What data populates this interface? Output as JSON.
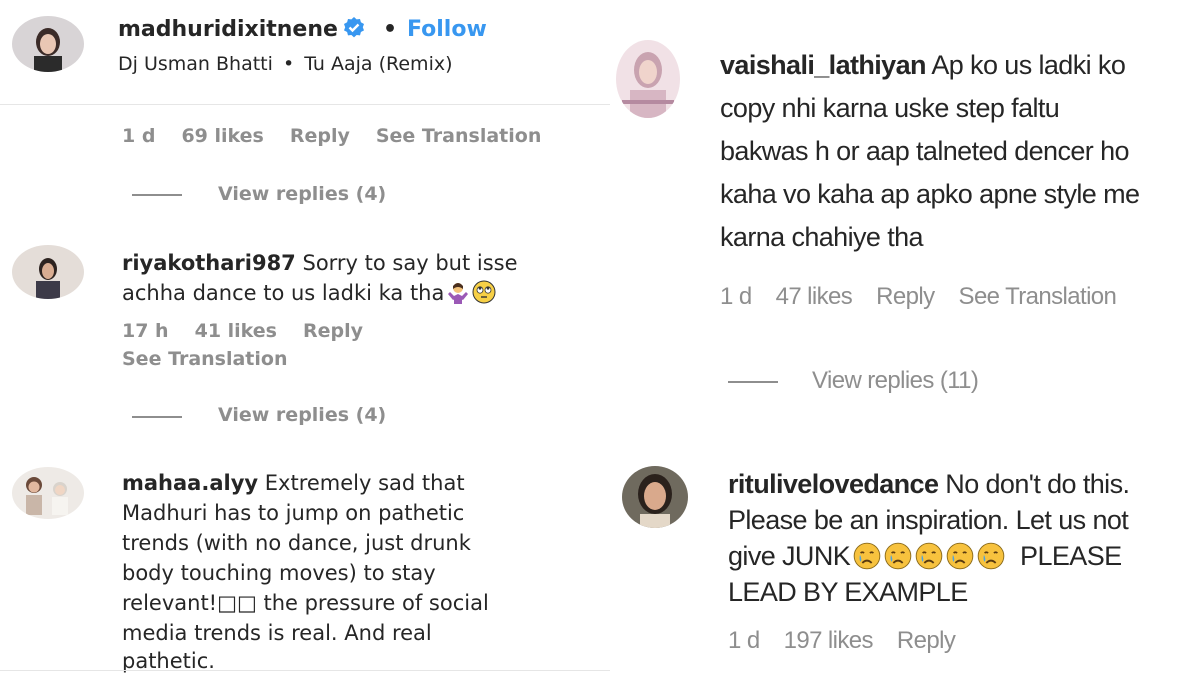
{
  "left": {
    "post_header": {
      "username": "madhuridixitnene",
      "separator": "•",
      "follow_label": "Follow",
      "audio_artist": "Dj Usman Bhatti",
      "audio_sep": "•",
      "audio_track": "Tu Aaja (Remix)"
    },
    "first_meta": {
      "time": "1 d",
      "likes": "69 likes",
      "reply": "Reply",
      "translate": "See Translation"
    },
    "first_view_replies": "View replies (4)",
    "comments": [
      {
        "username": "riyakothari987",
        "line1": "Sorry to say but isse",
        "line2": "achha dance to us ladki ka tha",
        "emojis": [
          "woman-gesturing-icon",
          "rolling-eyes-icon"
        ],
        "time": "17 h",
        "likes": "41 likes",
        "reply": "Reply",
        "translate": "See Translation",
        "view_replies": "View replies (4)"
      },
      {
        "username": "mahaa.alyy",
        "line1": "Extremely sad that",
        "line2": "Madhuri has to jump on pathetic",
        "line3": "trends (with no dance, just drunk",
        "line4": "body touching moves) to stay",
        "line5": "relevant!□□ the pressure of social",
        "line6": "media trends is real. And real",
        "line7": "pathetic."
      }
    ]
  },
  "right": {
    "comments": [
      {
        "username": "vaishali_lathiyan",
        "line1": "Ap ko us ladki ko",
        "line2": "copy nhi karna uske step faltu",
        "line3": "bakwas h or aap talneted dencer ho",
        "line4": "kaha vo kaha ap apko apne style me",
        "line5": "karna chahiye tha",
        "time": "1 d",
        "likes": "47 likes",
        "reply": "Reply",
        "translate": "See Translation",
        "view_replies": "View replies (11)"
      },
      {
        "username": "ritulivelovedance",
        "line1": "No don't do this.",
        "line2": "Please be an inspiration. Let us not",
        "line3_prefix": "give JUNK",
        "line3_suffix": "PLEASE",
        "line4": "LEAD BY EXAMPLE",
        "crying_emoji_count": 5,
        "time": "1 d",
        "likes": "197 likes",
        "reply": "Reply"
      }
    ]
  },
  "colors": {
    "text": "#262626",
    "meta": "#8e8e8e",
    "follow": "#3897f0",
    "verified": "#3897f0",
    "divider": "#e6e6e6"
  },
  "icons": {
    "verified": "verified-badge-icon",
    "crying": "crying-face-icon"
  }
}
